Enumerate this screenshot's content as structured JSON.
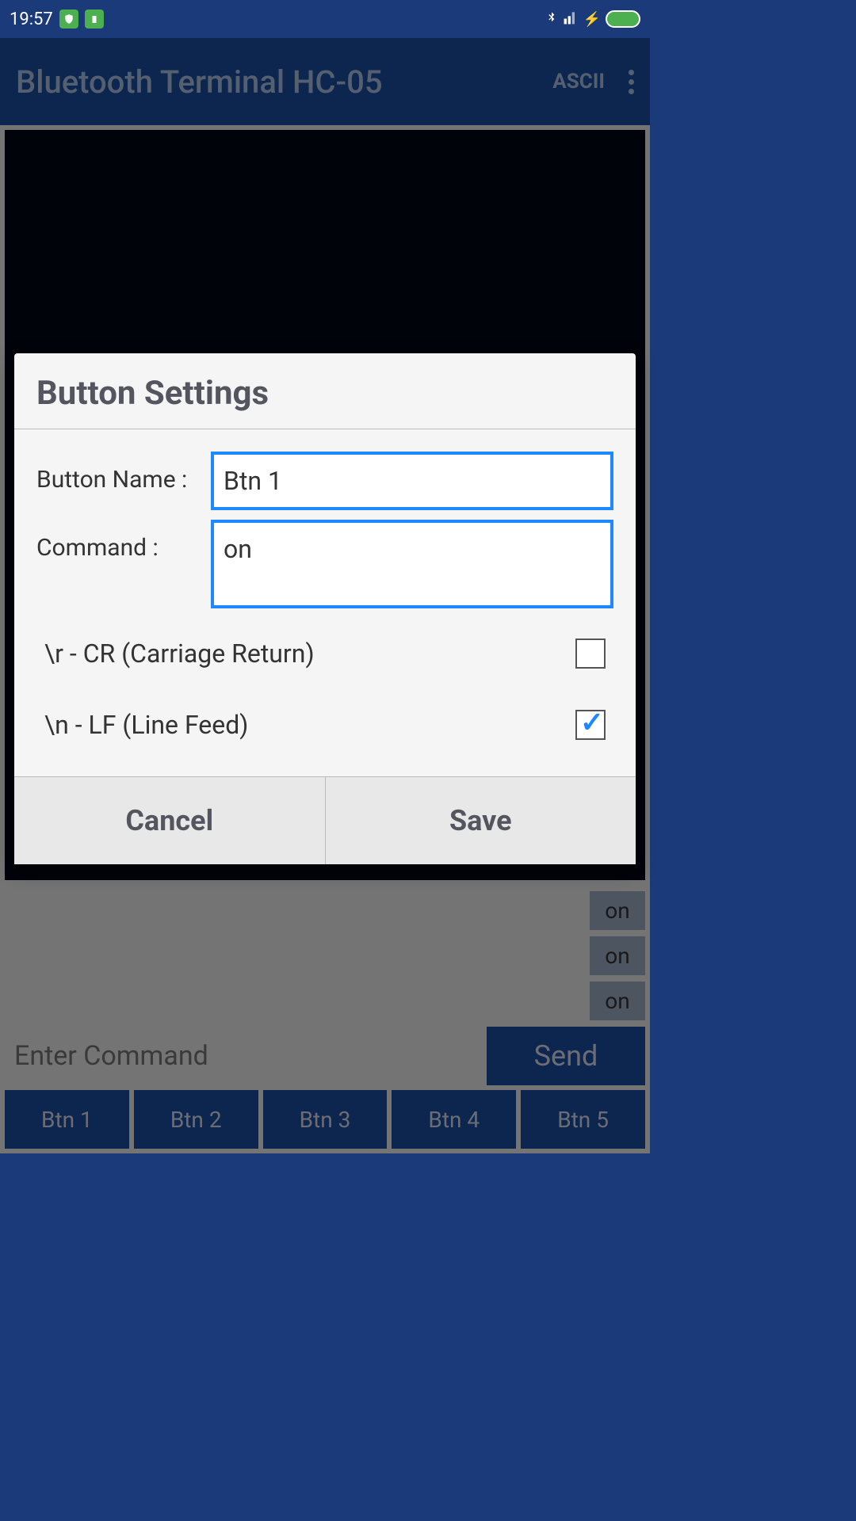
{
  "statusBar": {
    "time": "19:57"
  },
  "appBar": {
    "title": "Bluetooth Terminal HC-05",
    "asciiLabel": "ASCII"
  },
  "dialog": {
    "title": "Button Settings",
    "buttonNameLabel": "Button Name :",
    "buttonNameValue": "Btn 1",
    "commandLabel": "Command      :",
    "commandValue": "on",
    "crLabel": "\\r - CR (Carriage Return)",
    "crChecked": false,
    "lfLabel": "\\n - LF (Line Feed)",
    "lfChecked": true,
    "cancelLabel": "Cancel",
    "saveLabel": "Save"
  },
  "main": {
    "history": [
      "on",
      "on",
      "on"
    ],
    "commandPlaceholder": "Enter Command",
    "sendLabel": "Send",
    "buttons": [
      "Btn 1",
      "Btn 2",
      "Btn 3",
      "Btn 4",
      "Btn 5"
    ]
  }
}
